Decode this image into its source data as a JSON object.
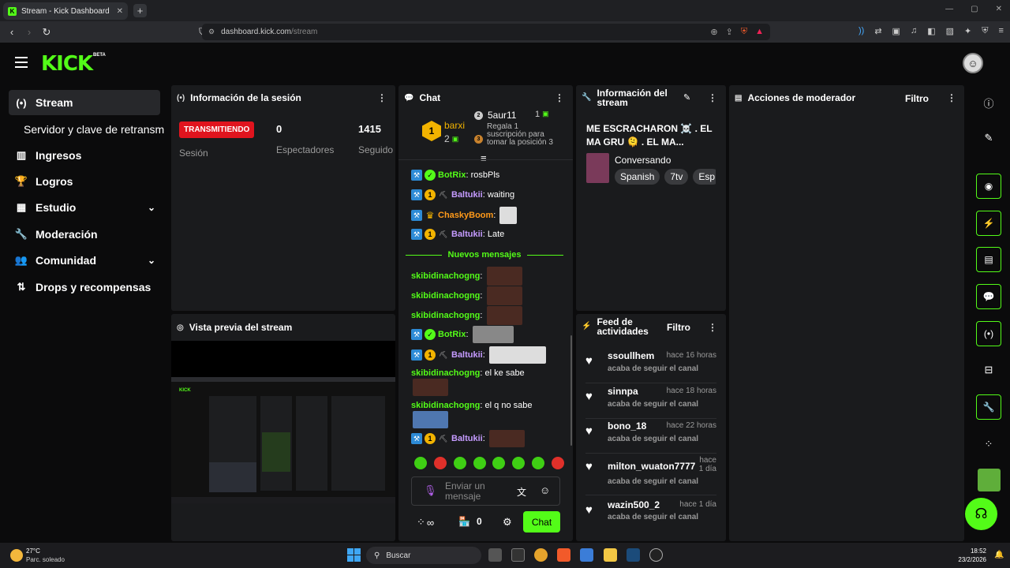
{
  "browser": {
    "tab_title": "Stream - Kick Dashboard",
    "tab_close": "✕",
    "new_tab": "+",
    "url_host": "dashboard.kick.com",
    "url_path": "/stream",
    "window_controls": [
      "—",
      "▢",
      "✕"
    ]
  },
  "header": {
    "logo": "KICK",
    "logo_badge": "BETA"
  },
  "sidebar": {
    "items": [
      {
        "icon": "(•)",
        "label": "Stream"
      },
      {
        "icon": "",
        "label": "Servidor y clave de retransm"
      },
      {
        "icon": "▥",
        "label": "Ingresos"
      },
      {
        "icon": "🏆",
        "label": "Logros"
      },
      {
        "icon": "▦",
        "label": "Estudio"
      },
      {
        "icon": "🔧",
        "label": "Moderación"
      },
      {
        "icon": "👥",
        "label": "Comunidad"
      },
      {
        "icon": "⇅",
        "label": "Drops y recompensas"
      }
    ]
  },
  "session": {
    "title": "Información de la sesión",
    "status_badge": "TRANSMITIENDO",
    "status_label": "Sesión",
    "viewers_value": "0",
    "viewers_label": "Espectadores",
    "followers_value": "1415",
    "followers_label": "Seguido"
  },
  "preview": {
    "title": "Vista previa del stream"
  },
  "chat": {
    "title": "Chat",
    "top_gifter_1_rank": "1",
    "top_gifter_1_name": "barxi",
    "top_gifter_1_count": "2",
    "top_gifter_2_rank": "2",
    "top_gifter_2_name": "5aur11",
    "top_gifter_2_count": "1",
    "top_gifter_3_rank": "3",
    "top_gifter_3_text": "Regala 1 suscripción para tomar la posición 3",
    "messages_before": [
      {
        "user": "BotRix",
        "text": "rosbPls"
      },
      {
        "user": "Baltukii",
        "text": "waiting"
      },
      {
        "user": "ChaskyBoom",
        "text": ""
      },
      {
        "user": "Baltukii",
        "text": "Late"
      }
    ],
    "new_messages_divider": "Nuevos mensajes",
    "messages_after": [
      {
        "user": "skibidinachogng",
        "text": ""
      },
      {
        "user": "skibidinachogng",
        "text": ""
      },
      {
        "user": "skibidinachogng",
        "text": ""
      },
      {
        "user": "BotRix",
        "text": ""
      },
      {
        "user": "Baltukii",
        "text": ""
      },
      {
        "user": "skibidinachogng",
        "text": "el ke sabe"
      },
      {
        "user": "skibidinachogng",
        "text": "el q no sabe"
      },
      {
        "user": "Baltukii",
        "text": ""
      }
    ],
    "badge_sub": "1",
    "input_placeholder": "Enviar un mensaje",
    "points_icon": "∞",
    "store_count": "0",
    "send_button": "Chat"
  },
  "stream_info": {
    "title": "Información del stream",
    "stream_title": "ME ESCRACHARON ☠️ . EL MA GRU 🫠 . EL MA...",
    "category": "Conversando",
    "tags": [
      "Spanish",
      "7tv",
      "Esp"
    ]
  },
  "feed": {
    "title": "Feed de actividades",
    "filter": "Filtro",
    "items": [
      {
        "user": "ssoullhem",
        "time": "hace 16 horas",
        "action": "acaba de seguir el canal"
      },
      {
        "user": "sinnpa",
        "time": "hace 18 horas",
        "action": "acaba de seguir el canal"
      },
      {
        "user": "bono_18",
        "time": "hace 22 horas",
        "action": "acaba de seguir el canal"
      },
      {
        "user": "milton_wuaton7777",
        "time": "hace 1 día",
        "action": "acaba de seguir el canal"
      },
      {
        "user": "wazin500_2",
        "time": "hace 1 día",
        "action": "acaba de seguir el canal"
      }
    ]
  },
  "mod_actions": {
    "title": "Acciones de moderador",
    "filter": "Filtro"
  },
  "taskbar": {
    "weather_temp": "27°C",
    "weather_desc": "Parc. soleado",
    "search_placeholder": "Buscar",
    "time": "18:52",
    "date": "23/2/2026"
  },
  "colors": {
    "accent": "#53fc18",
    "live": "#e0141e",
    "panel": "#1a1b1d",
    "background": "#0b0b0c"
  }
}
